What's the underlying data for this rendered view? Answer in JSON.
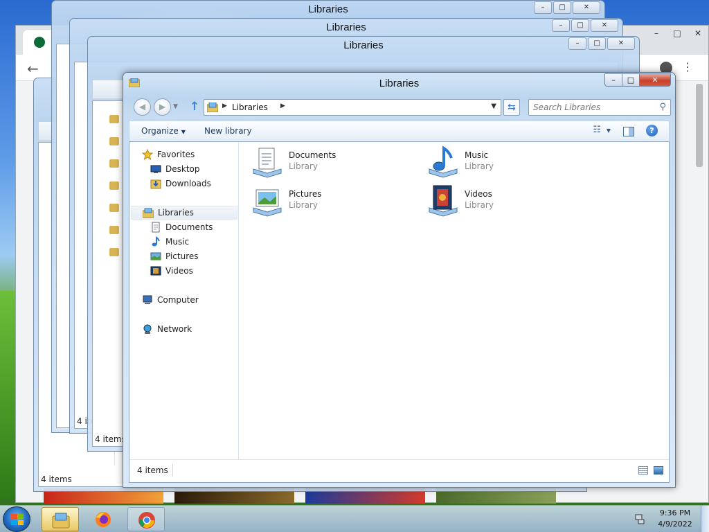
{
  "main_window": {
    "title": "Libraries",
    "breadcrumb": "Libraries",
    "search_placeholder": "Search Libraries",
    "toolbar": {
      "organize": "Organize",
      "new_library": "New library"
    },
    "nav": {
      "favorites": "Favorites",
      "desktop": "Desktop",
      "downloads": "Downloads",
      "libraries": "Libraries",
      "documents": "Documents",
      "music": "Music",
      "pictures": "Pictures",
      "videos": "Videos",
      "computer": "Computer",
      "network": "Network"
    },
    "items": [
      {
        "name": "Documents",
        "type": "Library",
        "icon": "documents-library-icon"
      },
      {
        "name": "Music",
        "type": "Library",
        "icon": "music-library-icon"
      },
      {
        "name": "Pictures",
        "type": "Library",
        "icon": "pictures-library-icon"
      },
      {
        "name": "Videos",
        "type": "Library",
        "icon": "videos-library-icon"
      }
    ],
    "status": "4 items",
    "caption_buttons": {
      "minimize": "–",
      "maximize": "□",
      "close": "✕"
    }
  },
  "background_windows": [
    {
      "title": "Libraries",
      "status": "4 items"
    },
    {
      "title": "Libraries",
      "status": "4 items"
    },
    {
      "title": "Libraries",
      "status": "4 items"
    },
    {
      "title": "Libraries",
      "status": "4 items"
    }
  ],
  "taskbar": {
    "time": "9:36 PM",
    "date": "4/9/2022",
    "apps": [
      "explorer-icon",
      "firefox-icon",
      "chrome-icon"
    ]
  },
  "colors": {
    "close_red": "#c8402a",
    "accent_blue": "#1f6ac0",
    "taskbar_active": "#e9c964"
  }
}
